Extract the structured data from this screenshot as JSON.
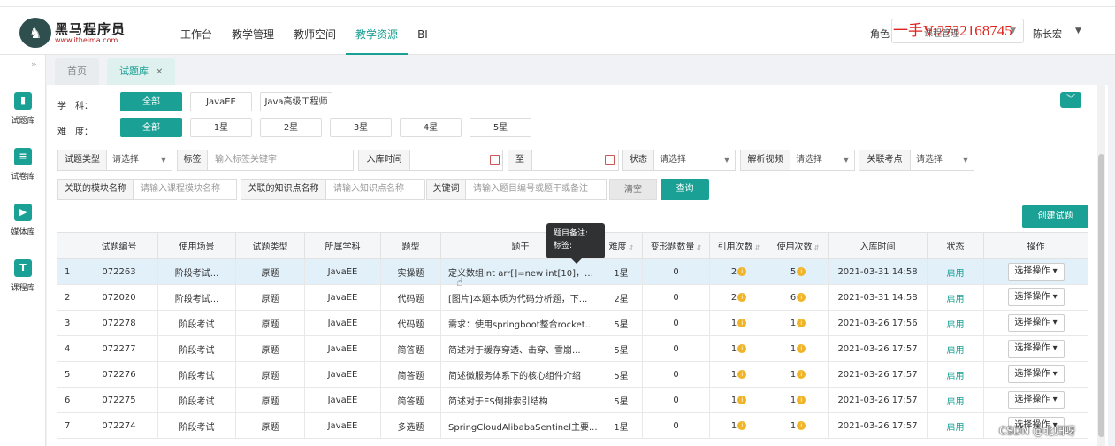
{
  "header": {
    "logo_text": "黑马程序员",
    "logo_url": "www.itheima.com",
    "nav": [
      "工作台",
      "教学管理",
      "教师空间",
      "教学资源",
      "BI"
    ],
    "nav_active": "教学资源",
    "role_label": "角色",
    "role_value": "课程管理",
    "watermark": "一手V:2732168745",
    "user_name": "陈长宏"
  },
  "sidebar": {
    "items": [
      {
        "label": "试题库",
        "icon": "book-icon"
      },
      {
        "label": "试卷库",
        "icon": "paper-icon"
      },
      {
        "label": "媒体库",
        "icon": "media-icon"
      },
      {
        "label": "课程库",
        "icon": "course-icon"
      }
    ]
  },
  "tabs": {
    "home": "首页",
    "current": "试题库"
  },
  "filters": {
    "subject_label": "学　科：",
    "subjects": [
      "全部",
      "JavaEE",
      "Java高级工程师"
    ],
    "difficulty_label": "难　度：",
    "difficulties": [
      "全部",
      "1星",
      "2星",
      "3星",
      "4星",
      "5星"
    ],
    "row1": {
      "type_label": "试题类型",
      "type_value": "请选择",
      "tag_label": "标签",
      "tag_placeholder": "输入标签关键字",
      "time_label": "入库时间",
      "to_label": "至",
      "status_label": "状态",
      "status_value": "请选择",
      "video_label": "解析视频",
      "video_value": "请选择",
      "point_label": "关联考点",
      "point_value": "请选择"
    },
    "row2": {
      "module_label": "关联的模块名称",
      "module_placeholder": "请输入课程模块名称",
      "knowledge_label": "关联的知识点名称",
      "knowledge_placeholder": "请输入知识点名称",
      "keyword_label": "关键词",
      "keyword_placeholder": "请输入题目编号或题干或备注",
      "clear_label": "清空",
      "query_label": "查询"
    },
    "create_label": "创建试题"
  },
  "table": {
    "headers": [
      "",
      "试题编号",
      "使用场景",
      "试题类型",
      "所属学科",
      "题型",
      "题干",
      "难度",
      "变形题数量",
      "引用次数",
      "使用次数",
      "入库时间",
      "状态",
      "操作"
    ],
    "rows": [
      {
        "idx": "1",
        "id": "072263",
        "scene": "阶段考试...",
        "type": "原题",
        "subject": "JavaEE",
        "qtype": "实操题",
        "stem": "定义数组int arr[]=new int[10]，需...",
        "level": "1星",
        "variants": "0",
        "refs": "2",
        "uses": "5",
        "time": "2021-03-31 14:58",
        "status": "启用",
        "op": "选择操作"
      },
      {
        "idx": "2",
        "id": "072020",
        "scene": "阶段考试...",
        "type": "原题",
        "subject": "JavaEE",
        "qtype": "代码题",
        "stem": "[图片]本题本质为代码分析题，下...",
        "level": "2星",
        "variants": "0",
        "refs": "2",
        "uses": "6",
        "time": "2021-03-31 14:58",
        "status": "启用",
        "op": "选择操作"
      },
      {
        "idx": "3",
        "id": "072278",
        "scene": "阶段考试",
        "type": "原题",
        "subject": "JavaEE",
        "qtype": "代码题",
        "stem": "需求：使用springboot整合rocket...",
        "level": "5星",
        "variants": "0",
        "refs": "1",
        "uses": "1",
        "time": "2021-03-26 17:56",
        "status": "启用",
        "op": "选择操作"
      },
      {
        "idx": "4",
        "id": "072277",
        "scene": "阶段考试",
        "type": "原题",
        "subject": "JavaEE",
        "qtype": "简答题",
        "stem": "简述对于缓存穿透、击穿、雪崩...",
        "level": "5星",
        "variants": "0",
        "refs": "1",
        "uses": "1",
        "time": "2021-03-26 17:57",
        "status": "启用",
        "op": "选择操作"
      },
      {
        "idx": "5",
        "id": "072276",
        "scene": "阶段考试",
        "type": "原题",
        "subject": "JavaEE",
        "qtype": "简答题",
        "stem": "简述微服务体系下的核心组件介绍",
        "level": "5星",
        "variants": "0",
        "refs": "1",
        "uses": "1",
        "time": "2021-03-26 17:57",
        "status": "启用",
        "op": "选择操作"
      },
      {
        "idx": "6",
        "id": "072275",
        "scene": "阶段考试",
        "type": "原题",
        "subject": "JavaEE",
        "qtype": "简答题",
        "stem": "简述对于ES倒排索引结构",
        "level": "5星",
        "variants": "0",
        "refs": "1",
        "uses": "1",
        "time": "2021-03-26 17:57",
        "status": "启用",
        "op": "选择操作"
      },
      {
        "idx": "7",
        "id": "072274",
        "scene": "阶段考试",
        "type": "原题",
        "subject": "JavaEE",
        "qtype": "多选题",
        "stem": "SpringCloudAlibabaSentinel主要...",
        "level": "1星",
        "variants": "0",
        "refs": "1",
        "uses": "1",
        "time": "2021-03-26 17:57",
        "status": "启用",
        "op": "选择操作"
      }
    ]
  },
  "tooltip": {
    "line1": "题目备注:",
    "line2": "标签:"
  },
  "footer_watermark": "CSDN @北归呀",
  "colors": {
    "accent": "#1aa094",
    "selected_row": "#e2f0fa",
    "watermark": "#e0221c"
  }
}
